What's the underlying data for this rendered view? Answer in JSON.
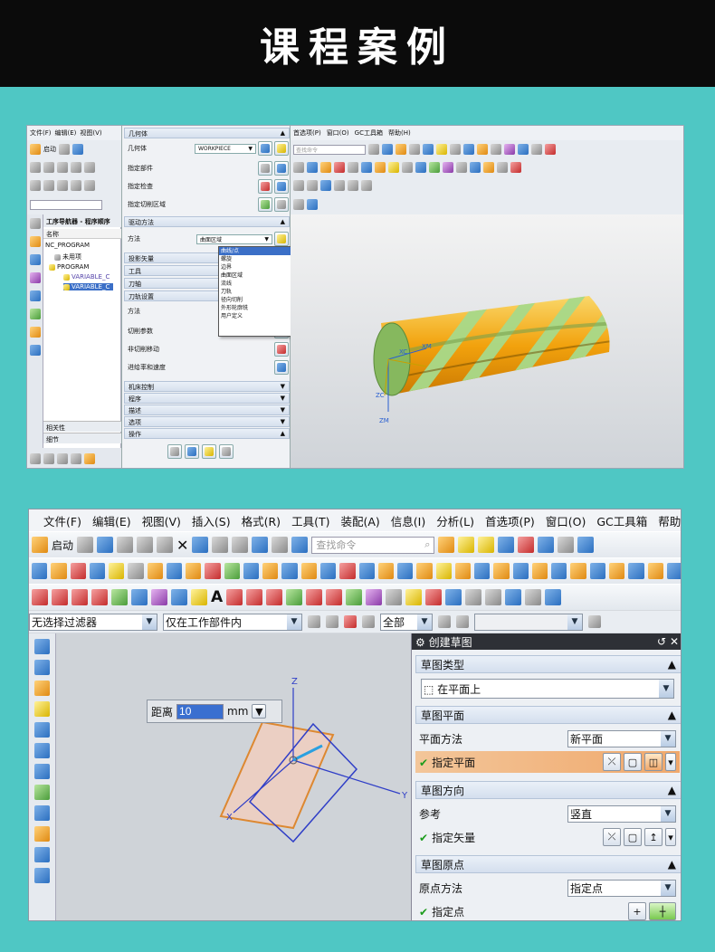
{
  "header": {
    "title": "课程案例"
  },
  "shot1": {
    "menu_left": [
      "文件(F)",
      "编辑(E)",
      "视图(V)"
    ],
    "menu_right": [
      "首选项(P)",
      "窗口(O)",
      "GC工具箱",
      "帮助(H)"
    ],
    "start_label": "启动",
    "search_placeholder": "查找命令",
    "navigator": {
      "title": "工序导航器 - 程序顺序",
      "column": "名称",
      "items": [
        "NC_PROGRAM",
        "未用项",
        "PROGRAM",
        "VARIABLE_C",
        "VARIABLE_C"
      ],
      "footer1": "相关性",
      "footer2": "细节"
    },
    "dialog": {
      "geometry_section": "几何体",
      "geometry_label": "几何体",
      "geometry_value": "WORKPIECE",
      "part_label": "指定部件",
      "check_label": "指定检查",
      "cut_region_label": "指定切削区域",
      "drive_section": "驱动方法",
      "method_label": "方法",
      "method_value": "曲面区域",
      "projection_section": "投影矢量",
      "tool_section": "工具",
      "axis_section": "刀轴",
      "path_section": "刀轨设置",
      "method2_label": "方法",
      "cut_params_label": "切削参数",
      "noncut_label": "非切削移动",
      "feed_label": "进给率和速度",
      "machine_section": "机床控制",
      "program_section": "程序",
      "desc_section": "描述",
      "options_section": "选项",
      "ops_section": "操作",
      "dropdown_options": [
        "曲线/点",
        "螺旋",
        "边界",
        "曲面区域",
        "流线",
        "刀轨",
        "径向切削",
        "外形轮廓铣",
        "用户定义"
      ]
    },
    "axes": {
      "xc": "XC",
      "xm": "XM",
      "zc": "ZC",
      "zm": "ZM"
    }
  },
  "shot2": {
    "menu": [
      "文件(F)",
      "编辑(E)",
      "视图(V)",
      "插入(S)",
      "格式(R)",
      "工具(T)",
      "装配(A)",
      "信息(I)",
      "分析(L)",
      "首选项(P)",
      "窗口(O)",
      "GC工具箱",
      "帮助(H)"
    ],
    "start_label": "启动",
    "search_placeholder": "查找命令",
    "filter": {
      "type": "无选择过滤器",
      "scope": "仅在工作部件内",
      "all": "全部"
    },
    "distance": {
      "label": "距离",
      "value": "10",
      "unit": "mm"
    },
    "axes": {
      "x": "X",
      "y": "Y",
      "z": "Z"
    },
    "dialog": {
      "title": "创建草图",
      "type_section": "草图类型",
      "type_value": "在平面上",
      "plane_section": "草图平面",
      "plane_method_label": "平面方法",
      "plane_method_value": "新平面",
      "specify_plane": "指定平面",
      "direction_section": "草图方向",
      "reference_label": "参考",
      "reference_value": "竖直",
      "specify_vector": "指定矢量",
      "origin_section": "草图原点",
      "origin_method_label": "原点方法",
      "origin_method_value": "指定点",
      "specify_point": "指定点"
    }
  }
}
